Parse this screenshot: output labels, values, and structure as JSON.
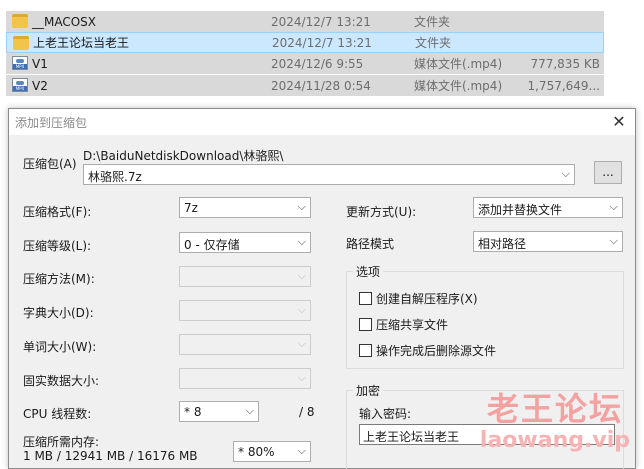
{
  "files": [
    {
      "name": "__MACOSX",
      "date": "2024/12/7 13:21",
      "type": "文件夹",
      "size": "",
      "icon": "folder-icon",
      "state": "gray"
    },
    {
      "name": "上老王论坛当老王",
      "date": "2024/12/7 13:21",
      "type": "文件夹",
      "size": "",
      "icon": "folder-icon",
      "state": "selected"
    },
    {
      "name": "V1",
      "date": "2024/12/6 9:55",
      "type": "媒体文件(.mp4)",
      "size": "777,835 KB",
      "icon": "mp4-file-icon",
      "state": "gray"
    },
    {
      "name": "V2",
      "date": "2024/11/28 0:54",
      "type": "媒体文件(.mp4)",
      "size": "1,757,649...",
      "icon": "mp4-file-icon",
      "state": "gray"
    }
  ],
  "dialog": {
    "title": "添加到压缩包",
    "close_glyph": "✕",
    "archive_label": "压缩包(A)",
    "archive_path": "D:\\BaiduNetdiskDownload\\林骆熙\\",
    "archive_name": "林骆熙.7z",
    "browse_label": "...",
    "left": {
      "format_label": "压缩格式(F):",
      "format_value": "7z",
      "level_label": "压缩等级(L):",
      "level_value": "0 - 仅存储",
      "method_label": "压缩方法(M):",
      "method_value": "",
      "dict_label": "字典大小(D):",
      "dict_value": "",
      "word_label": "单词大小(W):",
      "word_value": "",
      "solid_label": "固实数据大小:",
      "solid_value": "",
      "threads_label": "CPU 线程数:",
      "threads_value": "* 8",
      "threads_max": "/ 8",
      "memory_label": "压缩所需内存:",
      "memory_detail": "1 MB / 12941 MB / 16176 MB",
      "memory_value": "* 80%"
    },
    "right": {
      "update_label": "更新方式(U):",
      "update_value": "添加并替换文件",
      "path_label": "路径模式",
      "path_value": "相对路径",
      "options_title": "选项",
      "opt_sfx": "创建自解压程序(X)",
      "opt_shared": "压缩共享文件",
      "opt_delete": "操作完成后删除源文件",
      "encrypt_title": "加密",
      "password_label": "输入密码:",
      "password_value": "上老王论坛当老王"
    }
  },
  "watermark": {
    "line1": "老王论坛",
    "line2": "laowang.vip"
  },
  "colors": {
    "selected_row": "#cce8ff",
    "gray_row": "#d9d9d9",
    "dialog_bg": "#f0f0f0",
    "watermark": "#f3a1a1"
  }
}
